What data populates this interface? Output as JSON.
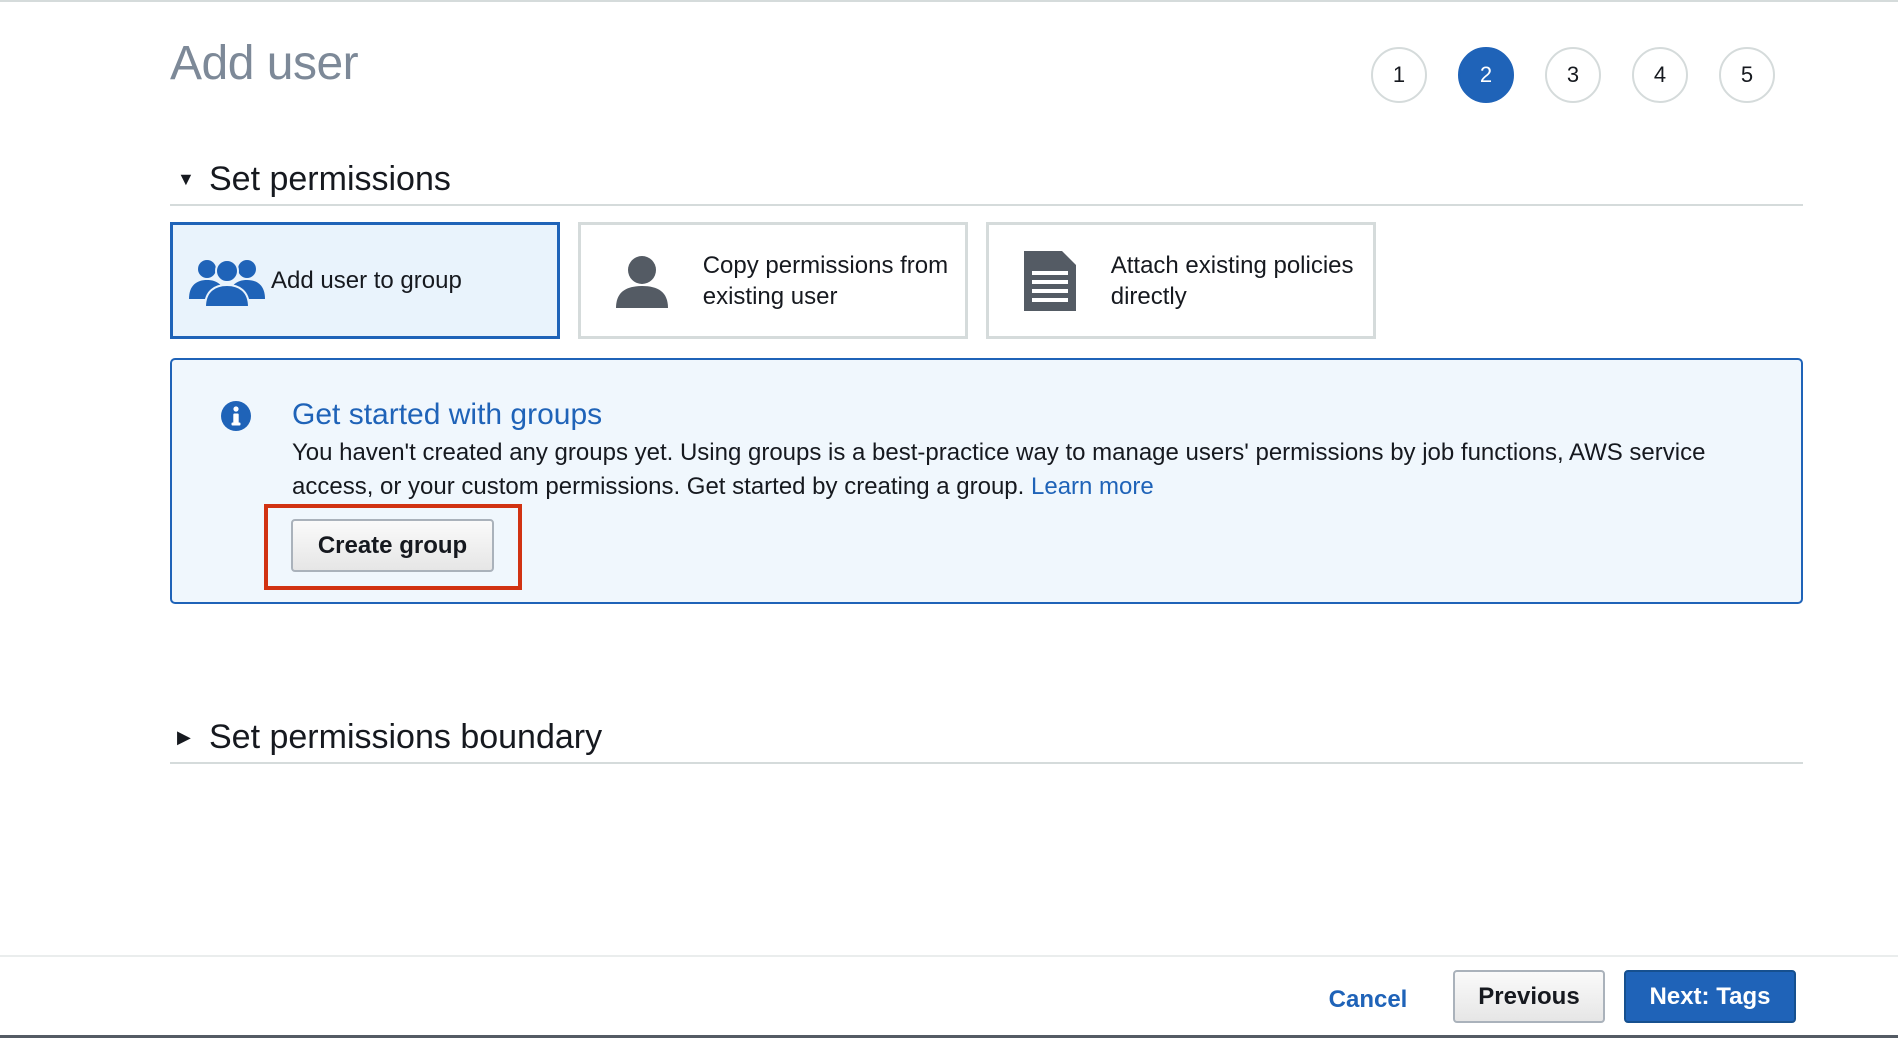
{
  "page": {
    "title": "Add user"
  },
  "steps": [
    "1",
    "2",
    "3",
    "4",
    "5"
  ],
  "active_step": "2",
  "set_permissions": {
    "title": "Set permissions",
    "options": [
      {
        "label": "Add user to group",
        "icon": "users-group-icon",
        "selected": true
      },
      {
        "label": "Copy permissions from existing user",
        "icon": "user-icon",
        "selected": false
      },
      {
        "label": "Attach existing policies directly",
        "icon": "document-icon",
        "selected": false
      }
    ]
  },
  "info": {
    "title": "Get started with groups",
    "text": "You haven't created any groups yet. Using groups is a best-practice way to manage users' permissions by job functions, AWS service access, or your custom permissions. Get started by creating a group.",
    "link": "Learn more",
    "button": "Create group"
  },
  "permissions_boundary": {
    "title": "Set permissions boundary"
  },
  "footer": {
    "cancel": "Cancel",
    "previous": "Previous",
    "next": "Next: Tags"
  },
  "colors": {
    "primary": "#1f63b8",
    "highlight": "#d13212",
    "info_bg": "#f0f7fd"
  }
}
